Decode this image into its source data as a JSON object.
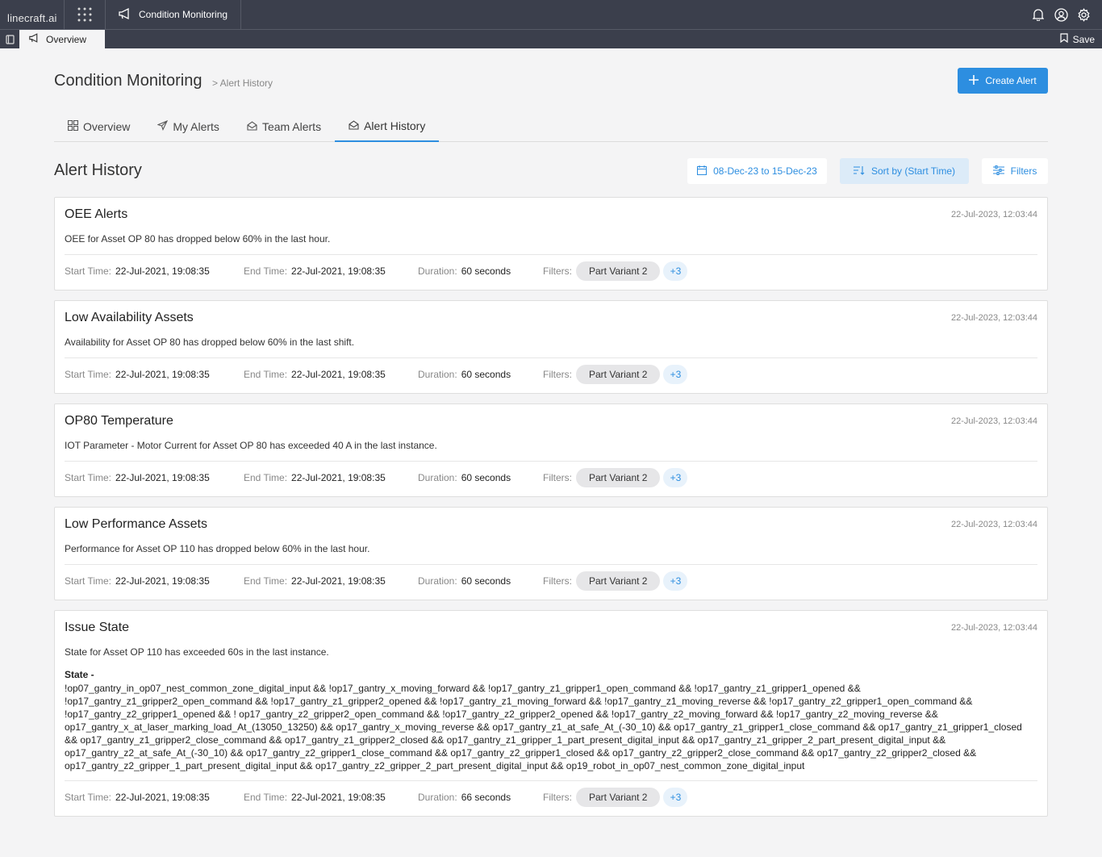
{
  "topbar": {
    "logo": "linecraft.ai",
    "app_title": "Condition Monitoring"
  },
  "subbar": {
    "tab": "Overview",
    "save": "Save"
  },
  "header": {
    "title": "Condition Monitoring",
    "breadcrumb": "> Alert History",
    "create_label": "Create Alert"
  },
  "tabs": [
    "Overview",
    "My Alerts",
    "Team Alerts",
    "Alert History"
  ],
  "section": {
    "title": "Alert History",
    "date_range": "08-Dec-23 to 15-Dec-23",
    "sort": "Sort by (Start Time)",
    "filters": "Filters"
  },
  "labels": {
    "start": "Start Time:",
    "end": "End Time:",
    "duration": "Duration:",
    "filters": "Filters:",
    "state": "State -"
  },
  "alerts": [
    {
      "title": "OEE Alerts",
      "stamp": "22-Jul-2023, 12:03:44",
      "desc": "OEE for Asset OP 80 has dropped below 60% in the last hour.",
      "start": "22-Jul-2021, 19:08:35",
      "end": "22-Jul-2021, 19:08:35",
      "duration": "60 seconds",
      "chip": "Part Variant 2",
      "more": "+3"
    },
    {
      "title": "Low Availability Assets",
      "stamp": "22-Jul-2023, 12:03:44",
      "desc": "Availability for Asset OP 80 has dropped below 60% in the last shift.",
      "start": "22-Jul-2021, 19:08:35",
      "end": "22-Jul-2021, 19:08:35",
      "duration": "60 seconds",
      "chip": "Part Variant 2",
      "more": "+3"
    },
    {
      "title": "OP80 Temperature",
      "stamp": "22-Jul-2023, 12:03:44",
      "desc": "IOT Parameter - Motor Current for Asset OP 80 has exceeded 40 A in the last instance.",
      "start": "22-Jul-2021, 19:08:35",
      "end": "22-Jul-2021, 19:08:35",
      "duration": "60 seconds",
      "chip": "Part Variant 2",
      "more": "+3"
    },
    {
      "title": "Low Performance Assets",
      "stamp": "22-Jul-2023, 12:03:44",
      "desc": "Performance for Asset OP 110 has dropped below 60% in the last hour.",
      "start": "22-Jul-2021, 19:08:35",
      "end": "22-Jul-2021, 19:08:35",
      "duration": "60 seconds",
      "chip": "Part Variant 2",
      "more": "+3"
    },
    {
      "title": "Issue State",
      "stamp": "22-Jul-2023, 12:03:44",
      "desc": "State for Asset OP 110 has exceeded 60s in the last instance.",
      "start": "22-Jul-2021, 19:08:35",
      "end": "22-Jul-2021, 19:08:35",
      "duration": "66 seconds",
      "chip": "Part Variant 2",
      "more": "+3",
      "state": "!op07_gantry_in_op07_nest_common_zone_digital_input && !op17_gantry_x_moving_forward && !op17_gantry_z1_gripper1_open_command && !op17_gantry_z1_gripper1_opened && !op17_gantry_z1_gripper2_open_command && !op17_gantry_z1_gripper2_opened && !op17_gantry_z1_moving_forward && !op17_gantry_z1_moving_reverse && !op17_gantry_z2_gripper1_open_command && !op17_gantry_z2_gripper1_opened && ! op17_gantry_z2_gripper2_open_command && !op17_gantry_z2_gripper2_opened && !op17_gantry_z2_moving_forward && !op17_gantry_z2_moving_reverse && op17_gantry_x_at_laser_marking_load_At_(13050_13250) && op17_gantry_x_moving_reverse && op17_gantry_z1_at_safe_At_(-30_10) && op17_gantry_z1_gripper1_close_command && op17_gantry_z1_gripper1_closed && op17_gantry_z1_gripper2_close_command && op17_gantry_z1_gripper2_closed && op17_gantry_z1_gripper_1_part_present_digital_input && op17_gantry_z1_gripper_2_part_present_digital_input && op17_gantry_z2_at_safe_At_(-30_10) && op17_gantry_z2_gripper1_close_command && op17_gantry_z2_gripper1_closed && op17_gantry_z2_gripper2_close_command && op17_gantry_z2_gripper2_closed && op17_gantry_z2_gripper_1_part_present_digital_input && op17_gantry_z2_gripper_2_part_present_digital_input && op19_robot_in_op07_nest_common_zone_digital_input"
    }
  ]
}
